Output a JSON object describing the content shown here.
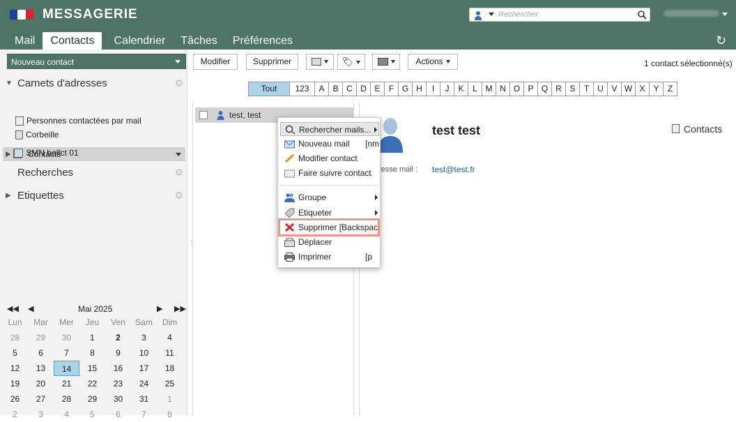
{
  "app": {
    "title": "MESSAGERIE",
    "flag_colors": [
      "#1d3f9e",
      "#ffffff",
      "#d9232e"
    ]
  },
  "search": {
    "placeholder": "Rechercher"
  },
  "tabs": [
    {
      "label": "Mail"
    },
    {
      "label": "Contacts",
      "active": true
    },
    {
      "label": "Calendrier"
    },
    {
      "label": "Tâches"
    },
    {
      "label": "Préférences"
    }
  ],
  "sidebar": {
    "new_contact_label": "Nouveau contact",
    "address_books_label": "Carnets d'adresses",
    "items": [
      {
        "label": "Contacts",
        "icon": "contact-book-icon"
      },
      {
        "label": "Personnes contactées par mail",
        "icon": "contact-book-icon"
      },
      {
        "label": "Corbeille",
        "icon": "trash-icon"
      },
      {
        "label": "SMN balfct 01",
        "icon": "shared-book-icon"
      }
    ],
    "searches_label": "Recherches",
    "labels_label": "Etiquettes"
  },
  "calendar": {
    "month_label": "Mai 2025",
    "weekdays": [
      "Lun",
      "Mar",
      "Mer",
      "Jeu",
      "Ven",
      "Sam",
      "Dim"
    ],
    "weeks": [
      [
        "28",
        "29",
        "30",
        "1",
        "2",
        "3",
        "4"
      ],
      [
        "5",
        "6",
        "7",
        "8",
        "9",
        "10",
        "11"
      ],
      [
        "12",
        "13",
        "14",
        "15",
        "16",
        "17",
        "18"
      ],
      [
        "19",
        "20",
        "21",
        "22",
        "23",
        "24",
        "25"
      ],
      [
        "26",
        "27",
        "28",
        "29",
        "30",
        "31",
        "1"
      ],
      [
        "2",
        "3",
        "4",
        "5",
        "6",
        "7",
        "8"
      ]
    ],
    "today": "14"
  },
  "toolbar": {
    "modify_label": "Modifier",
    "delete_label": "Supprimer",
    "actions_label": "Actions",
    "selection_status": "1 contact sélectionné(s)"
  },
  "alphabet": [
    "Tout",
    "123",
    "A",
    "B",
    "C",
    "D",
    "E",
    "F",
    "G",
    "H",
    "I",
    "J",
    "K",
    "L",
    "M",
    "N",
    "O",
    "P",
    "Q",
    "R",
    "S",
    "T",
    "U",
    "V",
    "W",
    "X",
    "Y",
    "Z"
  ],
  "contact_list": [
    {
      "name": "test, test"
    }
  ],
  "detail": {
    "name": "test test",
    "book": "Contacts",
    "email_label": "resse mail :",
    "email": "test@test.fr"
  },
  "context_menu": {
    "items": [
      {
        "label": "Rechercher mails...",
        "icon": "search-icon",
        "submenu": true
      },
      {
        "label": "Nouveau mail",
        "icon": "mail-icon",
        "shortcut": "[nm"
      },
      {
        "label": "Modifier contact",
        "icon": "pencil-icon"
      },
      {
        "label": "Faire suivre contact",
        "icon": "forward-icon"
      },
      {
        "label": "Groupe",
        "icon": "group-icon",
        "submenu": true
      },
      {
        "label": "Etiqueter",
        "icon": "tag-icon",
        "submenu": true
      },
      {
        "label": "Supprimer [Backspac",
        "icon": "delete-x-icon"
      },
      {
        "label": "Déplacer",
        "icon": "move-icon"
      },
      {
        "label": "Imprimer",
        "icon": "printer-icon",
        "shortcut": "[p"
      }
    ]
  }
}
